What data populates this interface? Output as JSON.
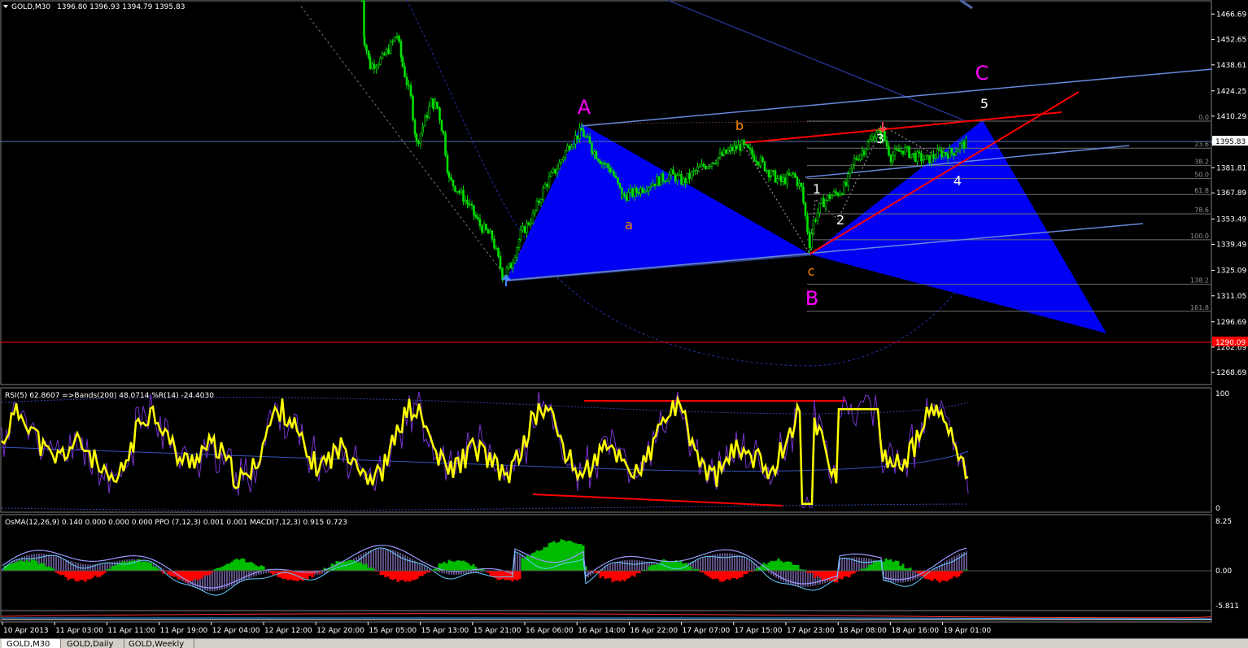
{
  "window": {
    "symbol_label": "GOLD,M30",
    "ohlc": "1396.80 1396.93 1394.79 1395.83"
  },
  "tabs": [
    {
      "label": "GOLD,M30",
      "active": true
    },
    {
      "label": "GOLD,Daily",
      "active": false
    },
    {
      "label": "GOLD,Weekly",
      "active": false
    }
  ],
  "colors": {
    "background": "#000000",
    "candle": "#00e000",
    "pattern_fill": "#0000ff",
    "trendline_red": "#ff0000",
    "channel_blue": "#6688dd",
    "rsi_line": "#ffff00",
    "osma_pos": "#00cc00",
    "osma_neg": "#ff0000",
    "macd_hist": "#c0a0ff",
    "grid": "#606060",
    "label_magenta": "#ff00ff",
    "label_orange": "#ff8800",
    "current_price_bg": "#ffffff",
    "alert_price_bg": "#ff0000"
  },
  "chart_data": [
    {
      "type": "candlestick",
      "title": "GOLD,M30",
      "ylim": [
        1262,
        1474
      ],
      "price_ticks": [
        "1466.69",
        "1452.65",
        "1438.61",
        "1424.25",
        "1410.29",
        "1395.83",
        "1381.81",
        "1367.89",
        "1353.49",
        "1339.49",
        "1325.09",
        "1311.05",
        "1296.69",
        "1282.69",
        "1268.69"
      ],
      "current_price": "1395.83",
      "alert_price": "1290.09",
      "time_labels": [
        "10 Apr 2013",
        "11 Apr 03:00",
        "11 Apr 11:00",
        "11 Apr 19:00",
        "12 Apr 04:00",
        "12 Apr 12:00",
        "12 Apr 20:00",
        "15 Apr 05:00",
        "15 Apr 13:00",
        "15 Apr 21:00",
        "16 Apr 06:00",
        "16 Apr 14:00",
        "16 Apr 22:00",
        "17 Apr 07:00",
        "17 Apr 15:00",
        "17 Apr 23:00",
        "18 Apr 08:00",
        "18 Apr 16:00",
        "19 Apr 01:00"
      ],
      "series_path": [
        [
          445,
          1474
        ],
        [
          448,
          1452
        ],
        [
          455,
          1438
        ],
        [
          470,
          1442
        ],
        [
          488,
          1455
        ],
        [
          495,
          1438
        ],
        [
          505,
          1420
        ],
        [
          512,
          1395
        ],
        [
          520,
          1405
        ],
        [
          530,
          1418
        ],
        [
          538,
          1415
        ],
        [
          545,
          1400
        ],
        [
          552,
          1375
        ],
        [
          562,
          1370
        ],
        [
          575,
          1362
        ],
        [
          590,
          1350
        ],
        [
          605,
          1343
        ],
        [
          618,
          1322
        ],
        [
          628,
          1328
        ],
        [
          640,
          1345
        ],
        [
          655,
          1355
        ],
        [
          670,
          1372
        ],
        [
          685,
          1382
        ],
        [
          700,
          1395
        ],
        [
          715,
          1402
        ],
        [
          728,
          1392
        ],
        [
          740,
          1385
        ],
        [
          752,
          1380
        ],
        [
          765,
          1366
        ],
        [
          780,
          1368
        ],
        [
          795,
          1372
        ],
        [
          810,
          1375
        ],
        [
          825,
          1378
        ],
        [
          840,
          1374
        ],
        [
          855,
          1380
        ],
        [
          870,
          1384
        ],
        [
          885,
          1388
        ],
        [
          900,
          1392
        ],
        [
          912,
          1394
        ],
        [
          922,
          1390
        ],
        [
          935,
          1385
        ],
        [
          948,
          1378
        ],
        [
          960,
          1374
        ],
        [
          975,
          1378
        ],
        [
          985,
          1370
        ],
        [
          995,
          1340
        ],
        [
          1000,
          1352
        ],
        [
          1010,
          1362
        ],
        [
          1020,
          1366
        ],
        [
          1030,
          1368
        ],
        [
          1040,
          1372
        ],
        [
          1050,
          1386
        ],
        [
          1062,
          1392
        ],
        [
          1075,
          1400
        ],
        [
          1085,
          1400
        ],
        [
          1095,
          1388
        ],
        [
          1110,
          1392
        ],
        [
          1125,
          1388
        ],
        [
          1140,
          1386
        ],
        [
          1155,
          1390
        ],
        [
          1170,
          1390
        ],
        [
          1180,
          1394
        ],
        [
          1190,
          1396
        ]
      ],
      "fib_levels": [
        {
          "label": "0.0",
          "price": 1407.5
        },
        {
          "label": "23.6",
          "price": 1392.6
        },
        {
          "label": "38.2",
          "price": 1383.0
        },
        {
          "label": "50.0",
          "price": 1375.8
        },
        {
          "label": "61.8",
          "price": 1367.0
        },
        {
          "label": "78.6",
          "price": 1356.3
        },
        {
          "label": "100.0",
          "price": 1342.0
        },
        {
          "label": "138.2",
          "price": 1317.4
        },
        {
          "label": "161.8",
          "price": 1302.5
        }
      ],
      "wave_labels": [
        {
          "text": "A",
          "color": "#ff00ff",
          "size": "big"
        },
        {
          "text": "B",
          "color": "#ff00ff",
          "size": "big"
        },
        {
          "text": "C",
          "color": "#ff00ff",
          "size": "big"
        },
        {
          "text": "a",
          "color": "#ff8800",
          "size": "small"
        },
        {
          "text": "b",
          "color": "#ff8800",
          "size": "small"
        },
        {
          "text": "c",
          "color": "#ff8800",
          "size": "small"
        },
        {
          "text": "1",
          "color": "#ffffff",
          "size": "small"
        },
        {
          "text": "2",
          "color": "#ffffff",
          "size": "small"
        },
        {
          "text": "3",
          "color": "#ffffff",
          "size": "small"
        },
        {
          "text": "4",
          "color": "#ffffff",
          "size": "small"
        },
        {
          "text": "5",
          "color": "#ffffff",
          "size": "small"
        }
      ]
    },
    {
      "type": "line",
      "title": "RSI(5) 62.8607  =>Bands(200) 48.0714  %R(14) -24.4030",
      "ylim": [
        0,
        100
      ],
      "ticks": [
        "100",
        "0"
      ],
      "series": [
        {
          "name": "RSI(5)",
          "value": "62.8607"
        },
        {
          "name": "Bands(200)",
          "value": "48.0714"
        },
        {
          "name": "%R(14)",
          "value": "-24.4030"
        }
      ]
    },
    {
      "type": "bar",
      "title": "OsMA(12,26,9) 0.140 0.000 0.000 0.000  PPO (7,12,3) 0.001 0.001  MACD(7,12,3) 0.915 0.723",
      "ylim": [
        -5.811,
        8.25
      ],
      "ticks": [
        "8.25",
        "0.00",
        "-5.811"
      ]
    }
  ]
}
